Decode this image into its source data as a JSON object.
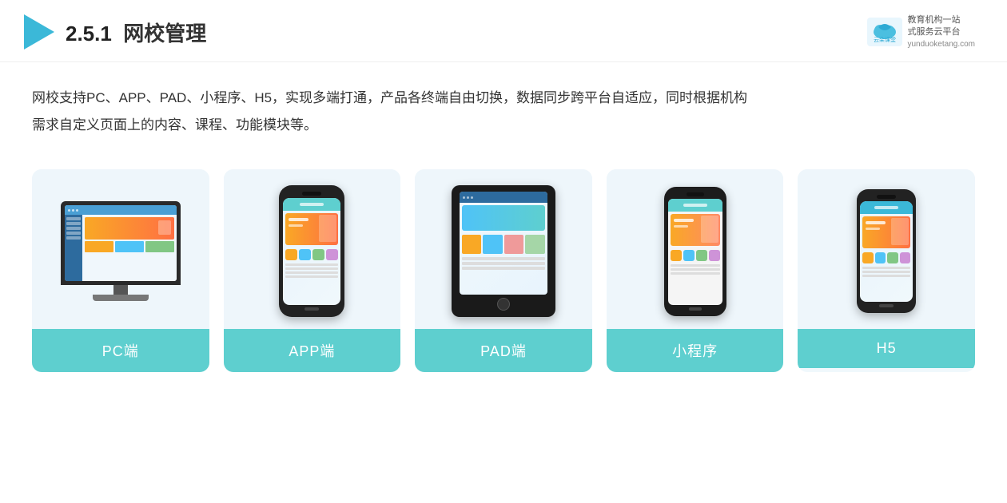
{
  "header": {
    "section_number": "2.5.1",
    "title_bold": "网校管理",
    "brand_name": "云朵课堂",
    "brand_url": "yunduoketang.com",
    "brand_tagline": "教育机构一站",
    "brand_tagline2": "式服务云平台"
  },
  "description": {
    "line1": "网校支持PC、APP、PAD、小程序、H5，实现多端打通，产品各终端自由切换，数据同步跨平台自适应，同时根据机构",
    "line2": "需求自定义页面上的内容、课程、功能模块等。"
  },
  "cards": [
    {
      "id": "pc",
      "label": "PC端"
    },
    {
      "id": "app",
      "label": "APP端"
    },
    {
      "id": "pad",
      "label": "PAD端"
    },
    {
      "id": "mini",
      "label": "小程序"
    },
    {
      "id": "h5",
      "label": "H5"
    }
  ]
}
